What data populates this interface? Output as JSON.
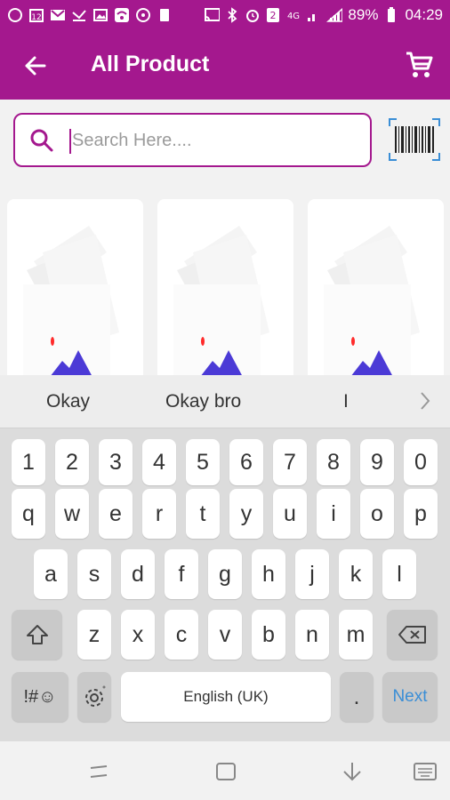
{
  "status_bar": {
    "battery": "89%",
    "time": "04:29"
  },
  "app_bar": {
    "title": "All Product"
  },
  "search": {
    "placeholder": "Search Here...."
  },
  "keyboard": {
    "suggestions": [
      "Okay",
      "Okay bro",
      "I"
    ],
    "row_numbers": [
      "1",
      "2",
      "3",
      "4",
      "5",
      "6",
      "7",
      "8",
      "9",
      "0"
    ],
    "row1": [
      "q",
      "w",
      "e",
      "r",
      "t",
      "y",
      "u",
      "i",
      "o",
      "p"
    ],
    "row2": [
      "a",
      "s",
      "d",
      "f",
      "g",
      "h",
      "j",
      "k",
      "l"
    ],
    "row3": [
      "z",
      "x",
      "c",
      "v",
      "b",
      "n",
      "m"
    ],
    "symbols_label": "!#☺",
    "space_label": "English (UK)",
    "period_label": ".",
    "next_label": "Next"
  },
  "colors": {
    "brand": "#a4188e",
    "next_text": "#3a8ed6"
  },
  "icons": {
    "back": "arrow-left-icon",
    "cart": "shopping-cart-icon",
    "search": "search-icon",
    "barcode": "barcode-scan-icon"
  }
}
